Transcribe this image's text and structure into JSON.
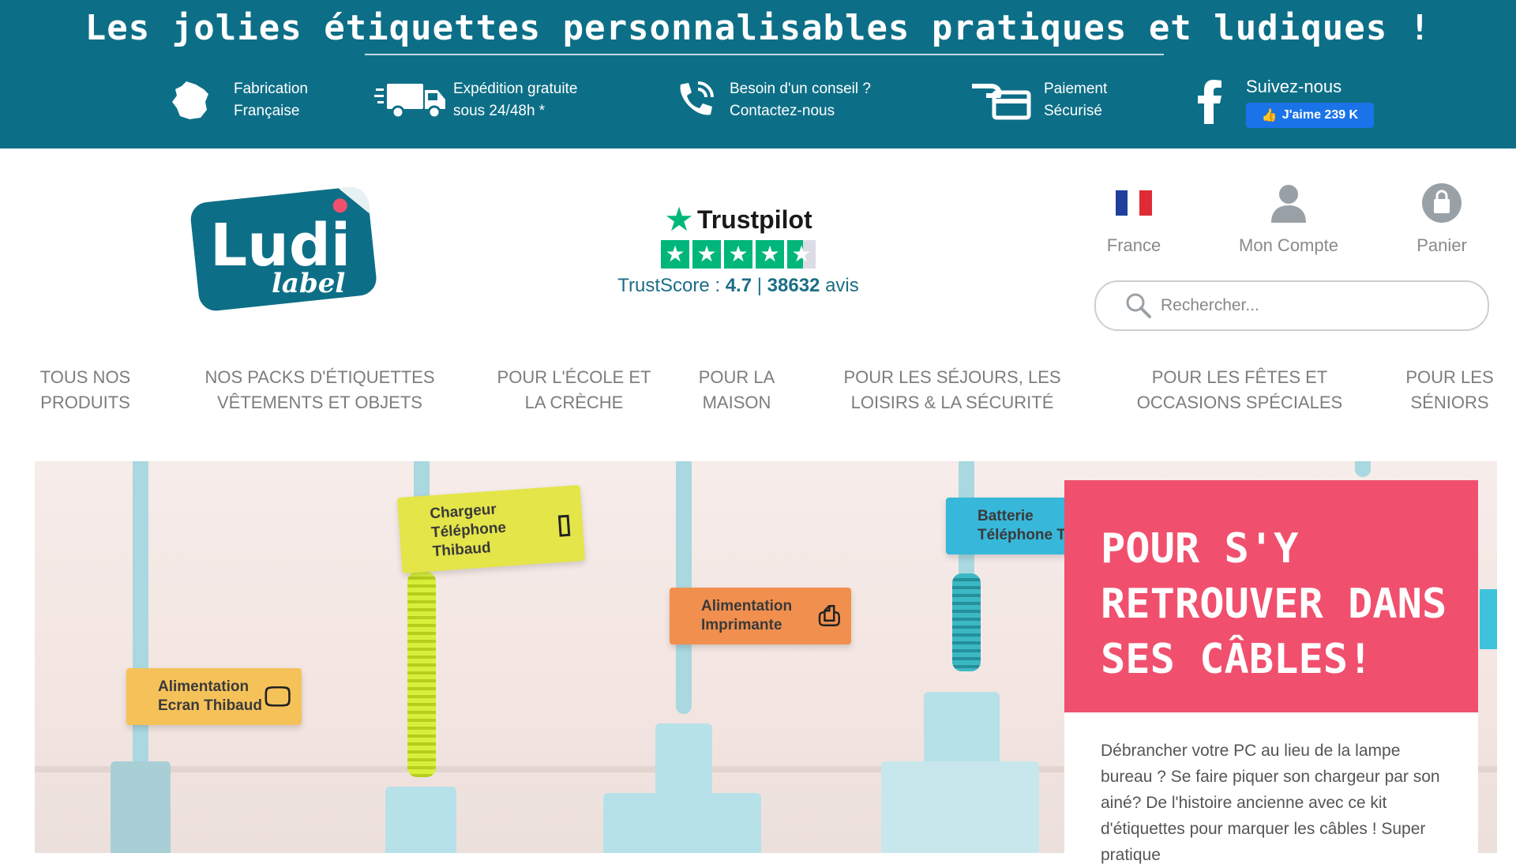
{
  "topbar": {
    "tagline": "Les jolies étiquettes personnalisables pratiques et ludiques !",
    "features": [
      {
        "icon": "france-map-icon",
        "line1": "Fabrication",
        "line2": "Française"
      },
      {
        "icon": "delivery-truck-icon",
        "line1": "Expédition gratuite",
        "line2": "sous 24/48h *"
      },
      {
        "icon": "phone-icon",
        "line1": "Besoin d'un conseil ?",
        "line2": "Contactez-nous"
      },
      {
        "icon": "payment-hand-icon",
        "line1": "Paiement",
        "line2": "Sécurisé"
      }
    ],
    "social": {
      "label": "Suivez-nous",
      "like_button": "J'aime 239 K",
      "icon": "facebook-icon"
    }
  },
  "header": {
    "logo_text": "Ludi",
    "logo_subtext": "label",
    "trustpilot": {
      "brand": "Trustpilot",
      "score_label": "TrustScore :",
      "score": "4.7",
      "separator": "|",
      "reviews": "38632",
      "reviews_label": "avis"
    },
    "country": {
      "label": "France",
      "icon": "france-flag-icon"
    },
    "account": {
      "label": "Mon Compte",
      "icon": "user-icon"
    },
    "cart": {
      "label": "Panier",
      "icon": "shopping-bag-icon"
    },
    "search": {
      "placeholder": "Rechercher...",
      "icon": "search-icon"
    }
  },
  "nav": [
    {
      "line1": "Tous nos",
      "line2": "produits"
    },
    {
      "line1": "Nos packs d'étiquettes",
      "line2": "vêtements et objets"
    },
    {
      "line1": "Pour l'école et",
      "line2": "la crèche"
    },
    {
      "line1": "Pour la",
      "line2": "maison"
    },
    {
      "line1": "Pour les séjours, les",
      "line2": "loisirs & la sécurité"
    },
    {
      "line1": "Pour les fêtes et",
      "line2": "occasions spéciales"
    },
    {
      "line1": "Pour les",
      "line2": "séniors"
    }
  ],
  "hero": {
    "labels": [
      {
        "line1": "Alimentation",
        "line2": "Ecran Thibaud",
        "color": "#f5c25a",
        "icon": "monitor-icon"
      },
      {
        "line1": "Chargeur",
        "line2": "Téléphone Thibaud",
        "color": "#e4e549",
        "icon": "smartphone-icon"
      },
      {
        "line1": "Alimentation",
        "line2": "Imprimante",
        "color": "#f08f4e",
        "icon": "printer-icon"
      },
      {
        "line1": "Batterie",
        "line2": "Téléphone Thiba",
        "color": "#37b7da",
        "icon": "battery-icon"
      }
    ],
    "promo": {
      "title": "Pour s'y retrouver dans ses câbles!",
      "text": "Débrancher votre PC au lieu de la lampe bureau ? Se faire piquer son chargeur par son ainé? De l'histoire ancienne avec ce kit d'étiquettes pour marquer les câbles ! Super pratique",
      "color": "#f0506e"
    }
  },
  "colors": {
    "brand_teal": "#0d6f87",
    "trustpilot_green": "#00b67a"
  }
}
